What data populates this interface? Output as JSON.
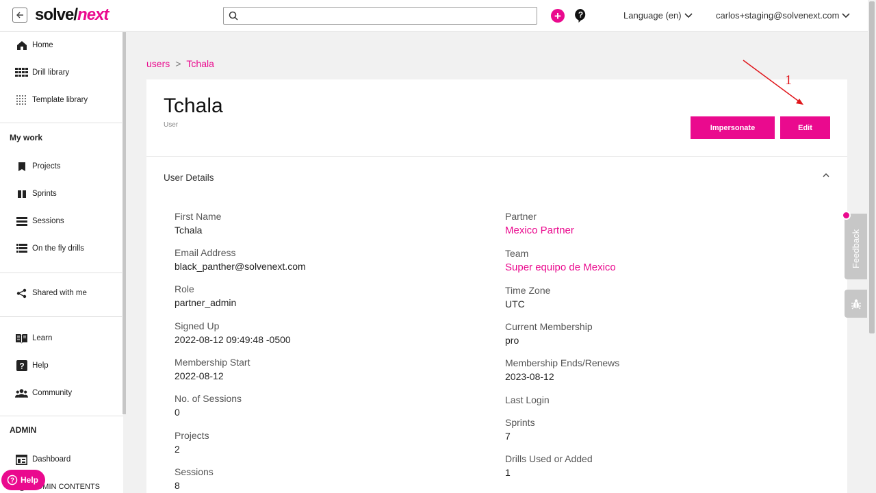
{
  "header": {
    "logo_a": "solve/",
    "logo_b": "next",
    "search_placeholder": "",
    "language_label": "Language (en)",
    "account_email": "carlos+staging@solvenext.com"
  },
  "sidebar": {
    "items_top": [
      {
        "label": "Home",
        "icon": "home-icon"
      },
      {
        "label": "Drill library",
        "icon": "grid-icon"
      },
      {
        "label": "Template library",
        "icon": "dotted-grid-icon"
      }
    ],
    "my_work_heading": "My work",
    "my_work_items": [
      {
        "label": "Projects",
        "icon": "bookmark-icon"
      },
      {
        "label": "Sprints",
        "icon": "columns-icon"
      },
      {
        "label": "Sessions",
        "icon": "list-icon"
      },
      {
        "label": "On the fly drills",
        "icon": "list-detail-icon"
      }
    ],
    "shared_label": "Shared with me",
    "help_items": [
      {
        "label": "Learn",
        "icon": "book-icon"
      },
      {
        "label": "Help",
        "icon": "question-icon"
      },
      {
        "label": "Community",
        "icon": "people-icon"
      }
    ],
    "admin_heading": "ADMIN",
    "admin_items": [
      {
        "label": "Dashboard",
        "icon": "dashboard-icon"
      },
      {
        "label": "ADMIN CONTENTS",
        "icon": "contents-icon"
      }
    ]
  },
  "help_fab_label": "Help",
  "breadcrumb": {
    "root": "users",
    "sep": ">",
    "current": "Tchala"
  },
  "user": {
    "name": "Tchala",
    "subtitle": "User",
    "impersonate_label": "Impersonate",
    "edit_label": "Edit",
    "section_title": "User Details"
  },
  "details_left": [
    {
      "label": "First Name",
      "value": "Tchala"
    },
    {
      "label": "Email Address",
      "value": "black_panther@solvenext.com"
    },
    {
      "label": "Role",
      "value": "partner_admin"
    },
    {
      "label": "Signed Up",
      "value": "2022-08-12 09:49:48 -0500"
    },
    {
      "label": "Membership Start",
      "value": "2022-08-12"
    },
    {
      "label": "No. of Sessions",
      "value": "0"
    },
    {
      "label": "Projects",
      "value": "2"
    },
    {
      "label": "Sessions",
      "value": "8"
    }
  ],
  "details_right": [
    {
      "label": "Partner",
      "value": "Mexico Partner"
    },
    {
      "label": "Team",
      "value": "Super equipo de Mexico"
    },
    {
      "label": "Time Zone",
      "value": "UTC"
    },
    {
      "label": "Current Membership",
      "value": "pro"
    },
    {
      "label": "Membership Ends/Renews",
      "value": "2023-08-12"
    },
    {
      "label": "Last Login",
      "value": ""
    },
    {
      "label": "Sprints",
      "value": "7"
    },
    {
      "label": "Drills Used or Added",
      "value": "1"
    }
  ],
  "feedback_label": "Feedback",
  "annotation_number": "1",
  "colors": {
    "accent": "#ea0a8e",
    "annotation": "#e0161b"
  }
}
